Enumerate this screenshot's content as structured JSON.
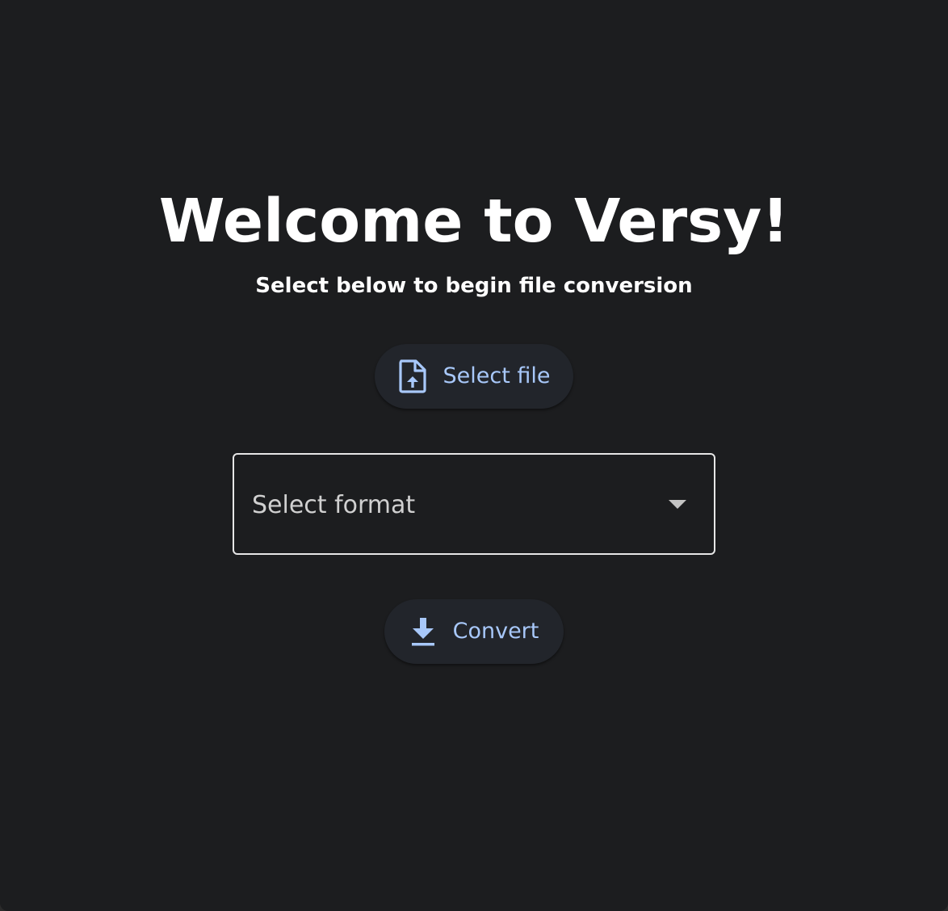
{
  "heading": {
    "title": "Welcome to Versy!",
    "subtitle": "Select below to begin file conversion"
  },
  "select_file_button": {
    "label": "Select file",
    "icon": "file-upload-icon"
  },
  "format_select": {
    "placeholder": "Select format",
    "icon": "caret-down-icon"
  },
  "convert_button": {
    "label": "Convert",
    "icon": "download-icon"
  },
  "colors": {
    "background": "#1c1d1f",
    "button_background": "#22252b",
    "accent": "#a8c8fa",
    "text": "#ffffff"
  }
}
